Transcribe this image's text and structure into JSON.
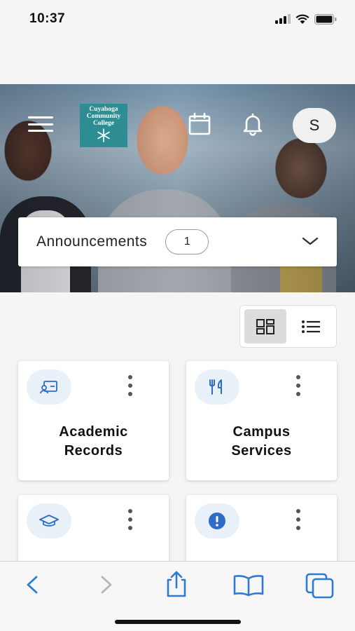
{
  "status_bar": {
    "time": "10:37"
  },
  "header": {
    "logo_text": [
      "Cuyahoga",
      "Community",
      "College"
    ],
    "avatar_initial": "S"
  },
  "announcements": {
    "label": "Announcements",
    "count": "1"
  },
  "view_toggle": {
    "active": "grid"
  },
  "cards": [
    {
      "title_line1": "Academic",
      "title_line2": "Records",
      "icon": "id-card-icon"
    },
    {
      "title_line1": "Campus",
      "title_line2": "Services",
      "icon": "utensils-icon"
    },
    {
      "title_line1": "",
      "title_line2": "",
      "icon": "graduation-cap-icon"
    },
    {
      "title_line1": "",
      "title_line2": "",
      "icon": "alert-circle-icon"
    }
  ],
  "colors": {
    "accent": "#2e6cc7",
    "logo_bg": "#2e8d92",
    "icon_circle": "#e8f0f8",
    "safari_blue": "#2e7bd6"
  }
}
